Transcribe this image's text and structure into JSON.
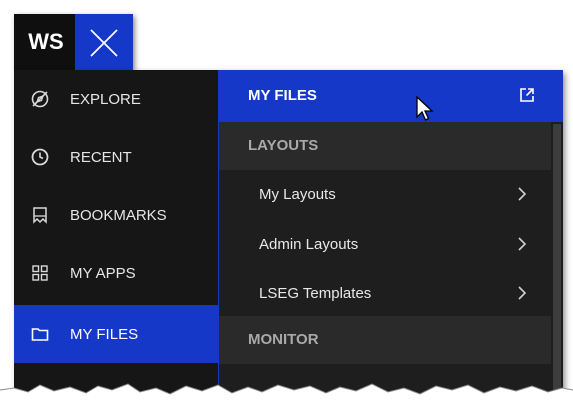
{
  "topbar": {
    "logo": "WS",
    "close_icon": "close-icon"
  },
  "sidebar": {
    "items": [
      {
        "label": "EXPLORE",
        "icon": "compass-slash-icon",
        "active": false
      },
      {
        "label": "RECENT",
        "icon": "clock-icon",
        "active": false
      },
      {
        "label": "BOOKMARKS",
        "icon": "bookmark-icon",
        "active": false
      },
      {
        "label": "MY APPS",
        "icon": "grid-icon",
        "active": false
      },
      {
        "label": "MY FILES",
        "icon": "folder-icon",
        "active": true
      }
    ]
  },
  "flyout": {
    "title": "MY FILES",
    "external_icon": "external-link-icon",
    "sections": [
      {
        "title": "LAYOUTS",
        "items": [
          {
            "label": "My Layouts",
            "icon": "chevron-right-icon"
          },
          {
            "label": "Admin Layouts",
            "icon": "chevron-right-icon"
          },
          {
            "label": "LSEG Templates",
            "icon": "chevron-right-icon"
          }
        ]
      },
      {
        "title": "MONITOR",
        "items": []
      }
    ]
  },
  "colors": {
    "accent": "#1638c9",
    "background": "#161616",
    "section_background": "#2a2a2a"
  }
}
